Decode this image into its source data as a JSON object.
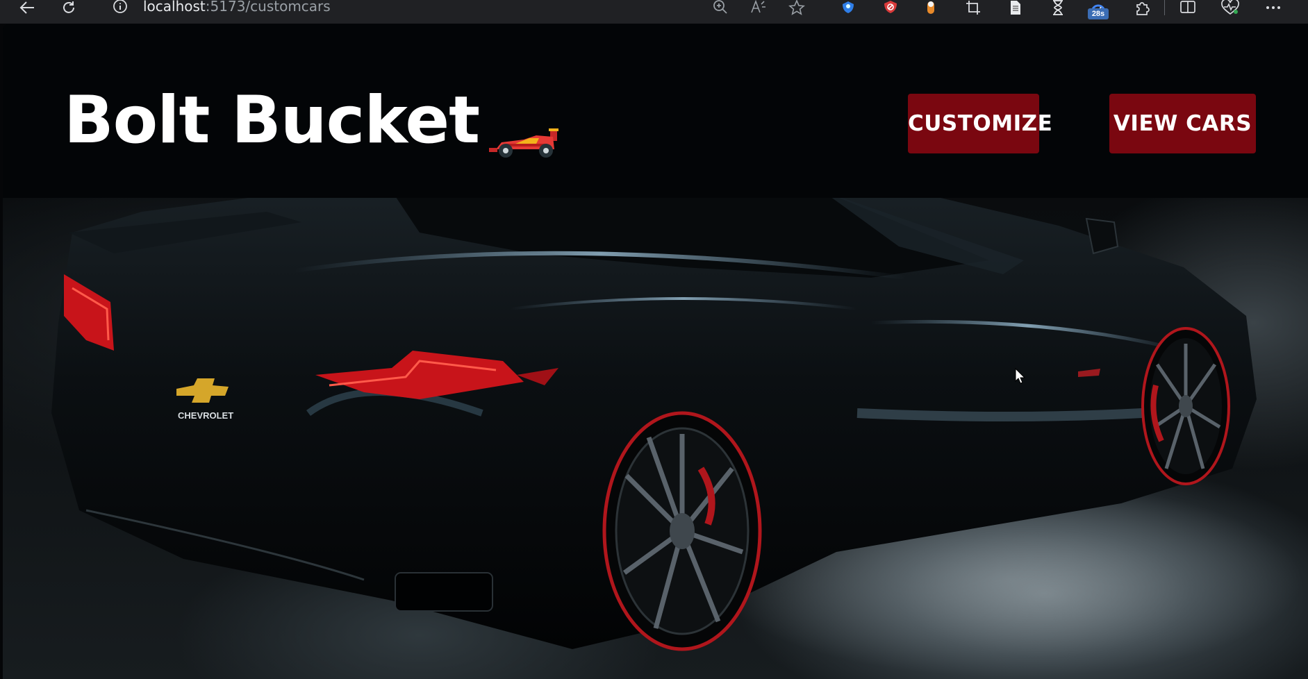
{
  "browser": {
    "url_host": "localhost",
    "url_path": ":5173/customcars",
    "badge": "28s",
    "icons": [
      "back-icon",
      "refresh-icon",
      "info-icon",
      "zoom-icon",
      "read-aloud-icon",
      "favorite-star-icon",
      "vpn-shield-icon",
      "adblock-icon",
      "extension-orange-icon",
      "screenshot-icon",
      "document-icon",
      "timer-icon",
      "speed-extension-icon",
      "puzzle-extensions-icon",
      "split-screen-icon",
      "performance-icon",
      "more-icon"
    ]
  },
  "header": {
    "title": "Bolt Bucket",
    "logo_icon": "race-car-icon",
    "buttons": {
      "customize": "CUSTOMIZE",
      "view_cars": "VIEW CARS"
    }
  },
  "hero": {
    "image": "black sports car rear three-quarter view",
    "badge_text": "CHEVROLET"
  },
  "colors": {
    "header_bg": "#030507",
    "button_bg": "#7a0710",
    "title": "#ffffff",
    "taillight_red": "#c8141a"
  }
}
